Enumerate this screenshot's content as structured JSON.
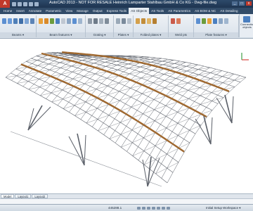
{
  "app": {
    "logo_letter": "A",
    "title": "AutoCAD 2013 - NOT FOR RESALE   Heinrich Lamparter Stahlbau GmbH & Co KG - Dwg-file.dwg",
    "window_controls": [
      "_",
      "□",
      "x"
    ]
  },
  "ribbon_tabs": [
    {
      "label": "Home",
      "active": false
    },
    {
      "label": "Insert",
      "active": false
    },
    {
      "label": "Annotate",
      "active": false
    },
    {
      "label": "Parametric",
      "active": false
    },
    {
      "label": "View",
      "active": false
    },
    {
      "label": "Manage",
      "active": false
    },
    {
      "label": "Output",
      "active": false
    },
    {
      "label": "Express Tools",
      "active": false
    },
    {
      "label": "AS Objects",
      "active": true
    },
    {
      "label": "AS Tools",
      "active": false
    },
    {
      "label": "AS Parametrics",
      "active": false
    },
    {
      "label": "AS BOM & NC",
      "active": false
    },
    {
      "label": "AS Detailing",
      "active": false
    }
  ],
  "ribbon_groups": {
    "beams": "Beams ▾",
    "beam_features": "Beam features ▾",
    "grating": "Grating ▾",
    "plates": "Plates ▾",
    "folded_plates": "Folded plates ▾",
    "weld_pts": "Weld pts",
    "plate_features": "Plate features ▾"
  },
  "connection_objects": "Connection objects",
  "layout_tabs": [
    {
      "label": "Model",
      "active": true
    },
    {
      "label": "Layout1",
      "active": false
    },
    {
      "label": "Layout2",
      "active": false
    }
  ],
  "status": {
    "coordinates": "445288.1",
    "workspace": "Initial Setup Workspace ▾"
  },
  "colors": {
    "titlebar": "#1e3450",
    "ribbon_tabs": "#314b68",
    "timber_arch": "#a0682e",
    "steel_lattice": "#5a5f68",
    "ucs_x": "#d9463e",
    "ucs_y": "#3fa045"
  }
}
